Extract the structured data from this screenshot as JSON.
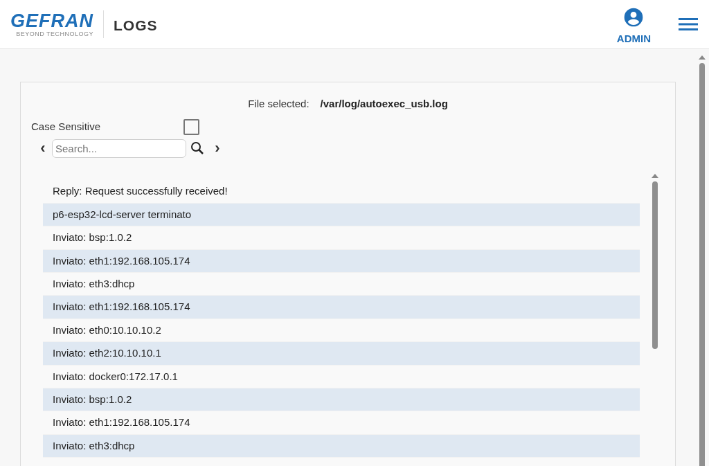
{
  "header": {
    "logo": "GEFRAN",
    "tagline": "BEYOND TECHNOLOGY",
    "title": "LOGS",
    "user": "ADMIN"
  },
  "file": {
    "label": "File selected:",
    "path": "/var/log/autoexec_usb.log"
  },
  "case_sensitive": {
    "label": "Case Sensitive",
    "checked": false
  },
  "search": {
    "placeholder": "Search...",
    "prev": "‹",
    "next": "›"
  },
  "log_lines": [
    "Reply: Request successfully received!",
    "p6-esp32-lcd-server terminato",
    "Inviato: bsp:1.0.2",
    "Inviato: eth1:192.168.105.174",
    "Inviato: eth3:dhcp",
    "Inviato: eth1:192.168.105.174",
    "Inviato: eth0:10.10.10.2",
    "Inviato: eth2:10.10.10.1",
    "Inviato: docker0:172.17.0.1",
    "Inviato: bsp:1.0.2",
    "Inviato: eth1:192.168.105.174",
    "Inviato: eth3:dhcp"
  ]
}
